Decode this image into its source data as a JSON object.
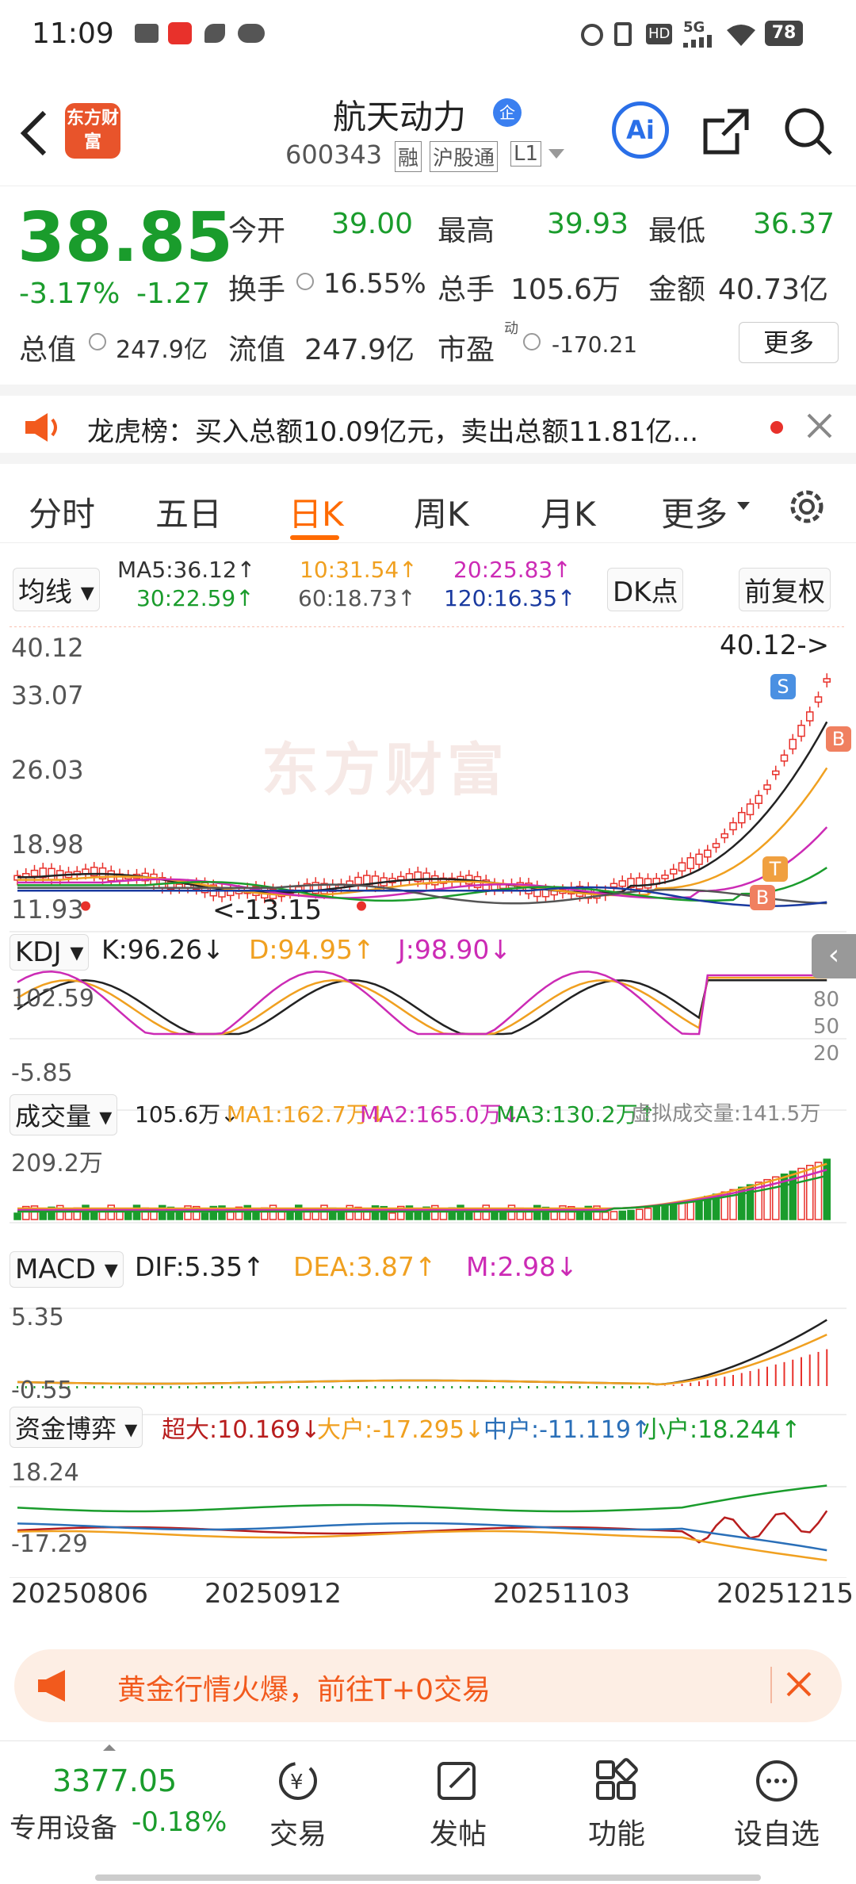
{
  "status_bar": {
    "time": "11:09",
    "battery": "78",
    "network": "5G"
  },
  "header": {
    "title": "航天动力",
    "title_badge": "企",
    "code": "600343",
    "tags": [
      "融",
      "沪股通",
      "L1"
    ],
    "logo_text": "东方财富",
    "ai_label": "Ai"
  },
  "quote": {
    "price": "38.85",
    "change_pct": "-3.17%",
    "change": "-1.27",
    "open_label": "今开",
    "open": "39.00",
    "high_label": "最高",
    "high": "39.93",
    "low_label": "最低",
    "low": "36.37",
    "turnover_label": "换手",
    "turnover": "16.55%",
    "volume_label": "总手",
    "volume": "105.6万",
    "amount_label": "金额",
    "amount": "40.73亿",
    "total_mv_label": "总值",
    "total_mv": "247.9亿",
    "float_mv_label": "流值",
    "float_mv": "247.9亿",
    "pe_label": "市盈",
    "pe_sup": "动",
    "pe": "-170.21",
    "more_button": "更多"
  },
  "notice": {
    "text": "龙虎榜：买入总额10.09亿元，卖出总额11.81亿..."
  },
  "tabs": [
    "分时",
    "五日",
    "日K",
    "周K",
    "月K",
    "更多"
  ],
  "active_tab": "日K",
  "ma_bar": {
    "selector": "均线",
    "ma5": "MA5:36.12↑",
    "ma10": "10:31.54↑",
    "ma20": "20:25.83↑",
    "ma30": "30:22.59↑",
    "ma60": "60:18.73↑",
    "ma120": "120:16.35↑",
    "dk_button": "DK点",
    "adjust_button": "前复权"
  },
  "kline": {
    "y_labels": [
      "40.12",
      "33.07",
      "26.03",
      "18.98",
      "11.93"
    ],
    "max_marker": "40.12->",
    "min_marker": "<-13.15",
    "watermark": "东方财富",
    "badges": [
      "S",
      "B",
      "T",
      "B"
    ]
  },
  "kdj": {
    "selector": "KDJ",
    "k": "K:96.26↓",
    "d": "D:94.95↑",
    "j": "J:98.90↓",
    "y_top": "102.59",
    "y_bottom": "-5.85",
    "levels": [
      "80",
      "50",
      "20"
    ]
  },
  "volume": {
    "selector": "成交量",
    "vol": "105.6万↓",
    "ma1": "MA1:162.7万↓",
    "ma2": "MA2:165.0万↓",
    "ma3": "MA3:130.2万↑",
    "virtual": "虚拟成交量:141.5万",
    "y_top": "209.2万"
  },
  "macd": {
    "selector": "MACD",
    "dif": "DIF:5.35↑",
    "dea": "DEA:3.87↑",
    "m": "M:2.98↓",
    "y_top": "5.35",
    "y_bottom": "-0.55"
  },
  "fund": {
    "selector": "资金博弈",
    "super": "超大:10.169↓",
    "large": "大户:-17.295↓",
    "mid": "中户:-11.119↑",
    "small": "小户:18.244↑",
    "y_top": "18.24",
    "y_bottom": "-17.29"
  },
  "dates": [
    "20250806",
    "20250912",
    "20251103",
    "20251215"
  ],
  "ad": {
    "text": "黄金行情火爆，前往T+0交易"
  },
  "bottom_nav": {
    "index_value": "3377.05",
    "device_label": "专用设备",
    "device_change": "-0.18%",
    "items": [
      "交易",
      "发帖",
      "功能",
      "设自选"
    ]
  },
  "colors": {
    "up": "#e8312b",
    "down": "#1a9c2c",
    "accent": "#ff6a00",
    "ma10": "#f0a020",
    "ma20": "#cc2bb5",
    "ma60": "#555555",
    "ma120": "#1a3aa0"
  }
}
